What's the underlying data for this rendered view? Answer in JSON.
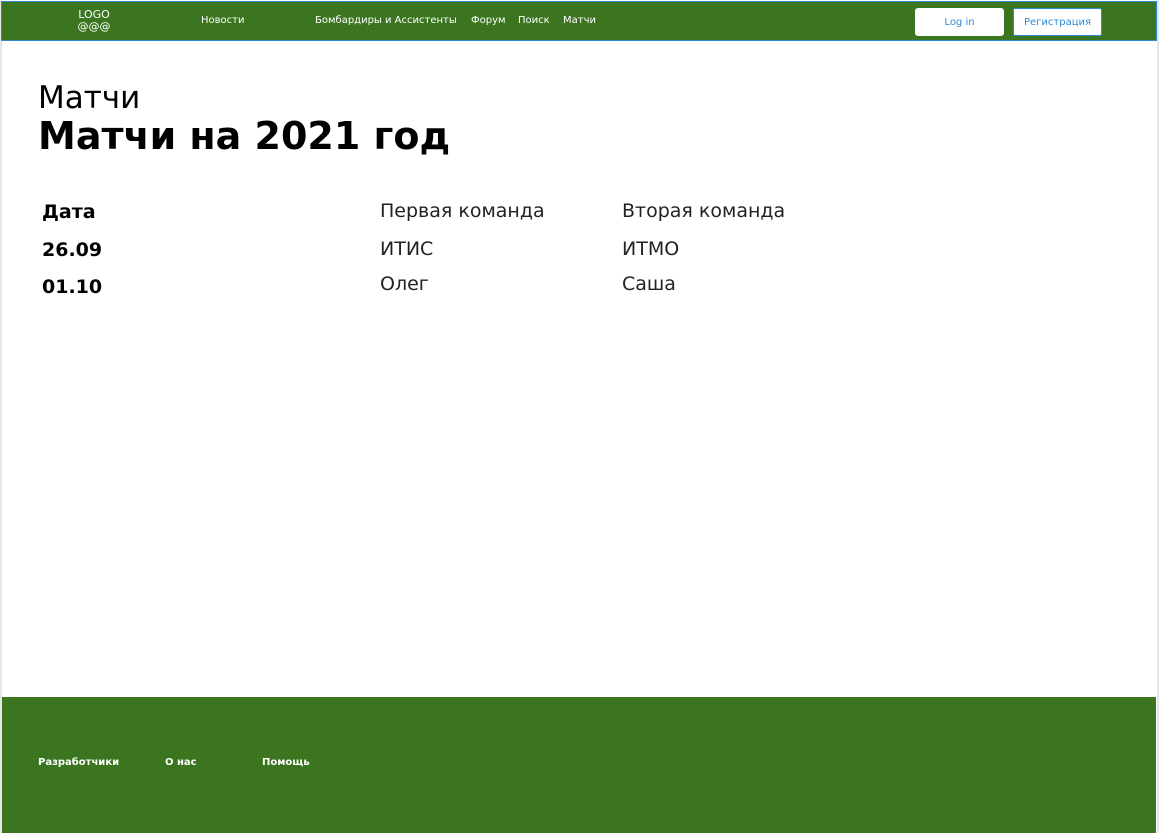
{
  "header": {
    "logo_line1": "LOGO",
    "logo_line2": "@@@",
    "nav": [
      {
        "label": "Новости"
      },
      {
        "label": "Бомбардиры и Ассистенты"
      },
      {
        "label": "Форум"
      },
      {
        "label": "Поиск"
      },
      {
        "label": "Матчи"
      }
    ],
    "login_label": "Log in",
    "register_label": "Регистрация"
  },
  "main": {
    "kicker": "Матчи",
    "title": "Матчи на 2021 год",
    "table": {
      "headers": [
        "Дата",
        "Первая команда",
        "Вторая команда"
      ],
      "rows": [
        [
          "26.09",
          "ИТИС",
          "ИТМО"
        ],
        [
          "01.10",
          "Олег",
          "Саша"
        ]
      ]
    }
  },
  "footer": {
    "links": [
      {
        "label": "Разработчики"
      },
      {
        "label": "О нас"
      },
      {
        "label": "Помощь"
      }
    ]
  },
  "colors": {
    "header_bg": "#3b7520",
    "footer_bg": "#3b7520",
    "accent_blue": "#2d8ad6"
  }
}
